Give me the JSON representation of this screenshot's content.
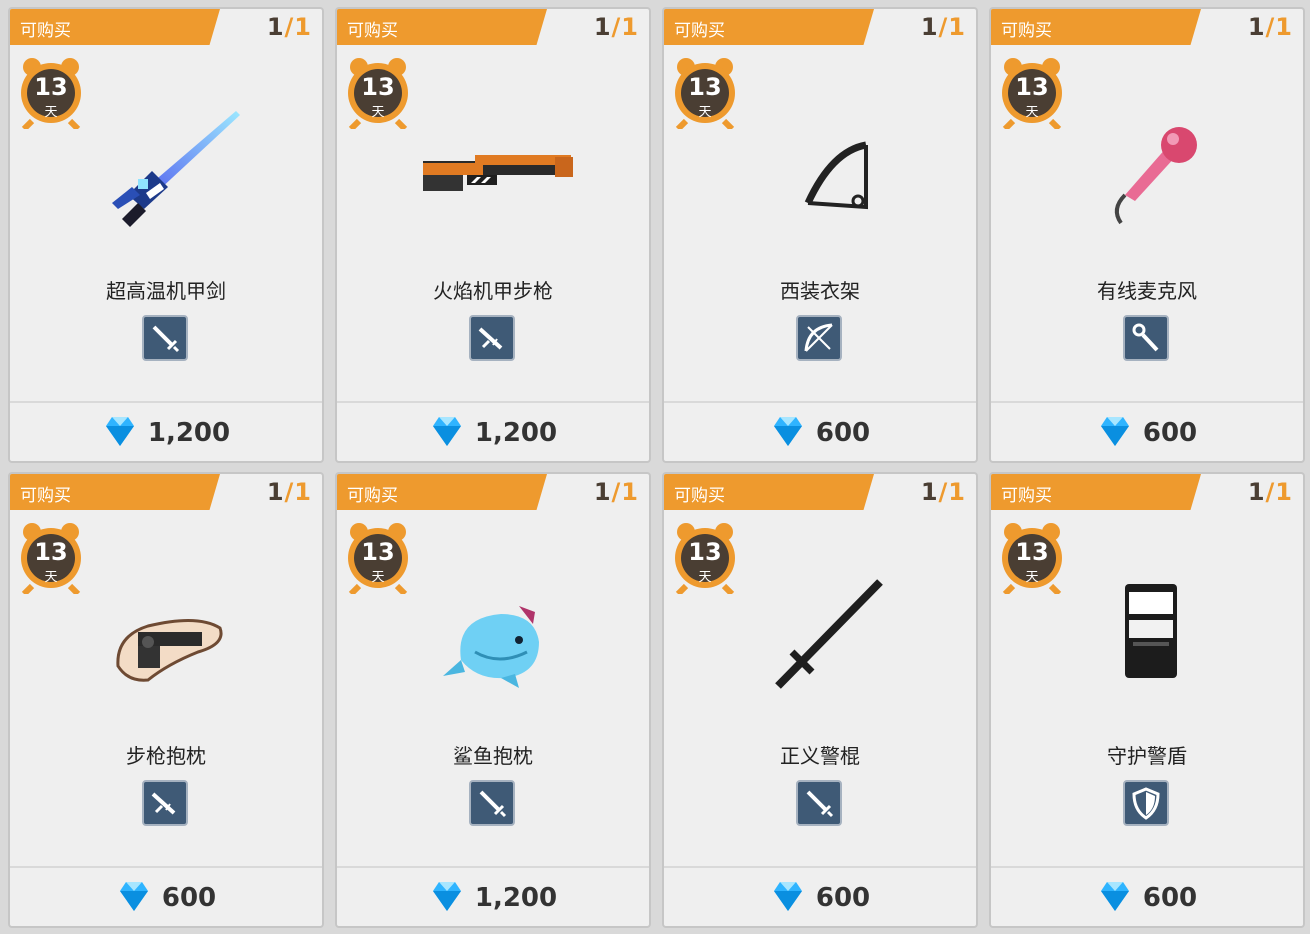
{
  "colors": {
    "tag": "#ee9a2e",
    "type_button": "#3f5a76",
    "gem": "#2fb4ff",
    "clock": "#4a3e33"
  },
  "items": [
    {
      "tag": "可购买",
      "count_cur": "1",
      "count_sep": "/",
      "count_max": "1",
      "days": "13",
      "days_unit": "天",
      "name": "超高温机甲剑",
      "price": "1,200",
      "type_icon": "sword-icon",
      "art": "mecha-sword"
    },
    {
      "tag": "可购买",
      "count_cur": "1",
      "count_sep": "/",
      "count_max": "1",
      "days": "13",
      "days_unit": "天",
      "name": "火焰机甲步枪",
      "price": "1,200",
      "type_icon": "rifle-icon",
      "art": "flame-rifle"
    },
    {
      "tag": "可购买",
      "count_cur": "1",
      "count_sep": "/",
      "count_max": "1",
      "days": "13",
      "days_unit": "天",
      "name": "西装衣架",
      "price": "600",
      "type_icon": "bow-icon",
      "art": "hanger-bow"
    },
    {
      "tag": "可购买",
      "count_cur": "1",
      "count_sep": "/",
      "count_max": "1",
      "days": "13",
      "days_unit": "天",
      "name": "有线麦克风",
      "price": "600",
      "type_icon": "staff-icon",
      "art": "microphone"
    },
    {
      "tag": "可购买",
      "count_cur": "1",
      "count_sep": "/",
      "count_max": "1",
      "days": "13",
      "days_unit": "天",
      "name": "步枪抱枕",
      "price": "600",
      "type_icon": "rifle-icon",
      "art": "gun-pillow"
    },
    {
      "tag": "可购买",
      "count_cur": "1",
      "count_sep": "/",
      "count_max": "1",
      "days": "13",
      "days_unit": "天",
      "name": "鲨鱼抱枕",
      "price": "1,200",
      "type_icon": "sword-icon",
      "art": "shark-pillow"
    },
    {
      "tag": "可购买",
      "count_cur": "1",
      "count_sep": "/",
      "count_max": "1",
      "days": "13",
      "days_unit": "天",
      "name": "正义警棍",
      "price": "600",
      "type_icon": "sword-icon",
      "art": "baton"
    },
    {
      "tag": "可购买",
      "count_cur": "1",
      "count_sep": "/",
      "count_max": "1",
      "days": "13",
      "days_unit": "天",
      "name": "守护警盾",
      "price": "600",
      "type_icon": "shield-icon",
      "art": "riot-shield"
    }
  ]
}
